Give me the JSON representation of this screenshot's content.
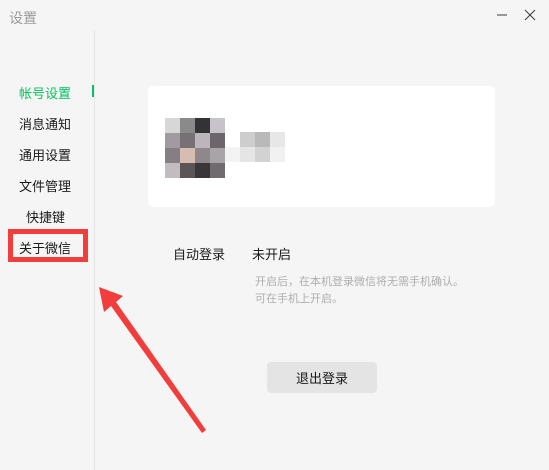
{
  "window": {
    "title": "设置"
  },
  "sidebar": {
    "items": [
      {
        "label": "帐号设置",
        "active": true
      },
      {
        "label": "消息通知",
        "active": false
      },
      {
        "label": "通用设置",
        "active": false
      },
      {
        "label": "文件管理",
        "active": false
      },
      {
        "label": "快捷键",
        "active": false
      },
      {
        "label": "关于微信",
        "active": false
      }
    ]
  },
  "account": {
    "avatar_icon": "pixelated-avatar",
    "nickname_icon": "pixelated-nickname",
    "auto_login": {
      "label": "自动登录",
      "value": "未开启",
      "description_line1": "开启后，在本机登录微信将无需手机确认。",
      "description_line2": "可在手机上开启。"
    },
    "logout_label": "退出登录"
  },
  "annotation": {
    "highlight_color": "#f23d3d"
  },
  "colors": {
    "accent": "#07c160",
    "background": "#f5f5f5",
    "card": "#ffffff",
    "button": "#e4e4e4"
  }
}
